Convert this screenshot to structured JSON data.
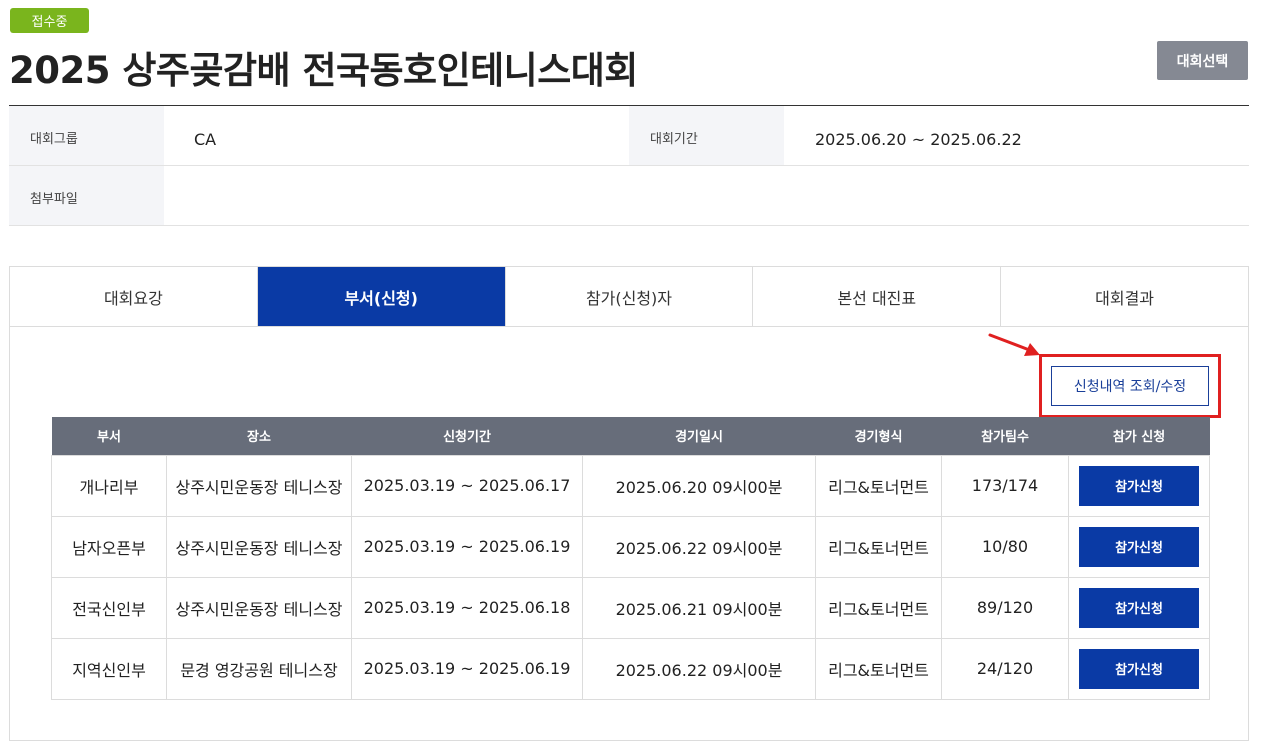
{
  "header": {
    "status_badge": "접수중",
    "title": "2025 상주곶감배 전국동호인테니스대회",
    "select_button": "대회선택"
  },
  "info": {
    "group_label": "대회그룹",
    "group_value": "CA",
    "period_label": "대회기간",
    "period_value": "2025.06.20 ~ 2025.06.22",
    "attachment_label": "첨부파일",
    "attachment_value": ""
  },
  "tabs": [
    {
      "label": "대회요강",
      "active": false
    },
    {
      "label": "부서(신청)",
      "active": true
    },
    {
      "label": "참가(신청)자",
      "active": false
    },
    {
      "label": "본선 대진표",
      "active": false
    },
    {
      "label": "대회결과",
      "active": false
    }
  ],
  "view_button": "신청내역 조회/수정",
  "table": {
    "headers": [
      "부서",
      "장소",
      "신청기간",
      "경기일시",
      "경기형식",
      "참가팀수",
      "참가 신청"
    ],
    "rows": [
      {
        "division": "개나리부",
        "venue": "상주시민운동장 테니스장",
        "period": "2025.03.19 ~ 2025.06.17",
        "datetime": "2025.06.20 09시00분",
        "format": "리그&토너먼트",
        "teams": "173/174",
        "action": "참가신청"
      },
      {
        "division": "남자오픈부",
        "venue": "상주시민운동장 테니스장",
        "period": "2025.03.19 ~ 2025.06.19",
        "datetime": "2025.06.22 09시00분",
        "format": "리그&토너먼트",
        "teams": "10/80",
        "action": "참가신청"
      },
      {
        "division": "전국신인부",
        "venue": "상주시민운동장 테니스장",
        "period": "2025.03.19 ~ 2025.06.18",
        "datetime": "2025.06.21 09시00분",
        "format": "리그&토너먼트",
        "teams": "89/120",
        "action": "참가신청"
      },
      {
        "division": "지역신인부",
        "venue": "문경 영강공원 테니스장",
        "period": "2025.03.19 ~ 2025.06.19",
        "datetime": "2025.06.22 09시00분",
        "format": "리그&토너먼트",
        "teams": "24/120",
        "action": "참가신청"
      }
    ]
  },
  "colors": {
    "badge": "#7ab51d",
    "accent": "#0a3aa5",
    "header_row": "#676d7a",
    "highlight": "#e02020"
  }
}
